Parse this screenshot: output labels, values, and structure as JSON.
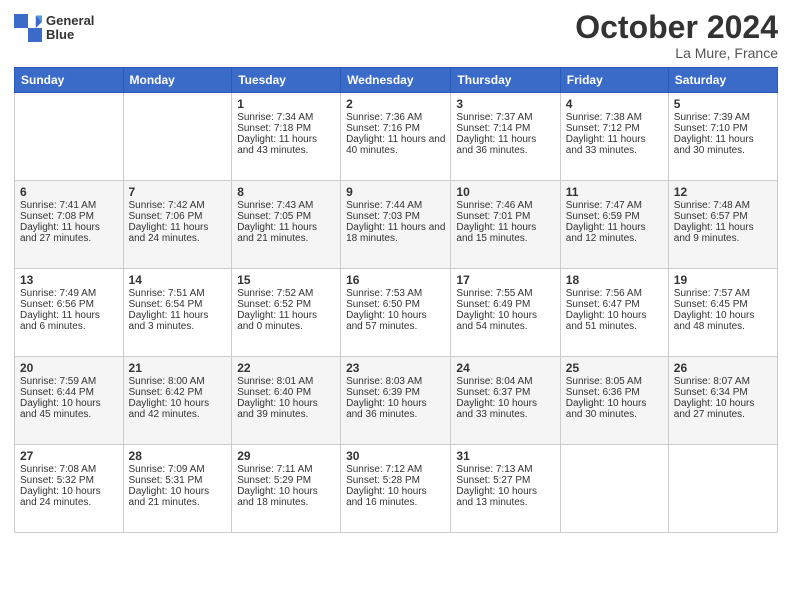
{
  "header": {
    "logo_line1": "General",
    "logo_line2": "Blue",
    "month": "October 2024",
    "location": "La Mure, France"
  },
  "days_of_week": [
    "Sunday",
    "Monday",
    "Tuesday",
    "Wednesday",
    "Thursday",
    "Friday",
    "Saturday"
  ],
  "weeks": [
    [
      {
        "day": "",
        "info": ""
      },
      {
        "day": "",
        "info": ""
      },
      {
        "day": "1",
        "info": "Sunrise: 7:34 AM\nSunset: 7:18 PM\nDaylight: 11 hours and 43 minutes."
      },
      {
        "day": "2",
        "info": "Sunrise: 7:36 AM\nSunset: 7:16 PM\nDaylight: 11 hours and 40 minutes."
      },
      {
        "day": "3",
        "info": "Sunrise: 7:37 AM\nSunset: 7:14 PM\nDaylight: 11 hours and 36 minutes."
      },
      {
        "day": "4",
        "info": "Sunrise: 7:38 AM\nSunset: 7:12 PM\nDaylight: 11 hours and 33 minutes."
      },
      {
        "day": "5",
        "info": "Sunrise: 7:39 AM\nSunset: 7:10 PM\nDaylight: 11 hours and 30 minutes."
      }
    ],
    [
      {
        "day": "6",
        "info": "Sunrise: 7:41 AM\nSunset: 7:08 PM\nDaylight: 11 hours and 27 minutes."
      },
      {
        "day": "7",
        "info": "Sunrise: 7:42 AM\nSunset: 7:06 PM\nDaylight: 11 hours and 24 minutes."
      },
      {
        "day": "8",
        "info": "Sunrise: 7:43 AM\nSunset: 7:05 PM\nDaylight: 11 hours and 21 minutes."
      },
      {
        "day": "9",
        "info": "Sunrise: 7:44 AM\nSunset: 7:03 PM\nDaylight: 11 hours and 18 minutes."
      },
      {
        "day": "10",
        "info": "Sunrise: 7:46 AM\nSunset: 7:01 PM\nDaylight: 11 hours and 15 minutes."
      },
      {
        "day": "11",
        "info": "Sunrise: 7:47 AM\nSunset: 6:59 PM\nDaylight: 11 hours and 12 minutes."
      },
      {
        "day": "12",
        "info": "Sunrise: 7:48 AM\nSunset: 6:57 PM\nDaylight: 11 hours and 9 minutes."
      }
    ],
    [
      {
        "day": "13",
        "info": "Sunrise: 7:49 AM\nSunset: 6:56 PM\nDaylight: 11 hours and 6 minutes."
      },
      {
        "day": "14",
        "info": "Sunrise: 7:51 AM\nSunset: 6:54 PM\nDaylight: 11 hours and 3 minutes."
      },
      {
        "day": "15",
        "info": "Sunrise: 7:52 AM\nSunset: 6:52 PM\nDaylight: 11 hours and 0 minutes."
      },
      {
        "day": "16",
        "info": "Sunrise: 7:53 AM\nSunset: 6:50 PM\nDaylight: 10 hours and 57 minutes."
      },
      {
        "day": "17",
        "info": "Sunrise: 7:55 AM\nSunset: 6:49 PM\nDaylight: 10 hours and 54 minutes."
      },
      {
        "day": "18",
        "info": "Sunrise: 7:56 AM\nSunset: 6:47 PM\nDaylight: 10 hours and 51 minutes."
      },
      {
        "day": "19",
        "info": "Sunrise: 7:57 AM\nSunset: 6:45 PM\nDaylight: 10 hours and 48 minutes."
      }
    ],
    [
      {
        "day": "20",
        "info": "Sunrise: 7:59 AM\nSunset: 6:44 PM\nDaylight: 10 hours and 45 minutes."
      },
      {
        "day": "21",
        "info": "Sunrise: 8:00 AM\nSunset: 6:42 PM\nDaylight: 10 hours and 42 minutes."
      },
      {
        "day": "22",
        "info": "Sunrise: 8:01 AM\nSunset: 6:40 PM\nDaylight: 10 hours and 39 minutes."
      },
      {
        "day": "23",
        "info": "Sunrise: 8:03 AM\nSunset: 6:39 PM\nDaylight: 10 hours and 36 minutes."
      },
      {
        "day": "24",
        "info": "Sunrise: 8:04 AM\nSunset: 6:37 PM\nDaylight: 10 hours and 33 minutes."
      },
      {
        "day": "25",
        "info": "Sunrise: 8:05 AM\nSunset: 6:36 PM\nDaylight: 10 hours and 30 minutes."
      },
      {
        "day": "26",
        "info": "Sunrise: 8:07 AM\nSunset: 6:34 PM\nDaylight: 10 hours and 27 minutes."
      }
    ],
    [
      {
        "day": "27",
        "info": "Sunrise: 7:08 AM\nSunset: 5:32 PM\nDaylight: 10 hours and 24 minutes."
      },
      {
        "day": "28",
        "info": "Sunrise: 7:09 AM\nSunset: 5:31 PM\nDaylight: 10 hours and 21 minutes."
      },
      {
        "day": "29",
        "info": "Sunrise: 7:11 AM\nSunset: 5:29 PM\nDaylight: 10 hours and 18 minutes."
      },
      {
        "day": "30",
        "info": "Sunrise: 7:12 AM\nSunset: 5:28 PM\nDaylight: 10 hours and 16 minutes."
      },
      {
        "day": "31",
        "info": "Sunrise: 7:13 AM\nSunset: 5:27 PM\nDaylight: 10 hours and 13 minutes."
      },
      {
        "day": "",
        "info": ""
      },
      {
        "day": "",
        "info": ""
      }
    ]
  ]
}
